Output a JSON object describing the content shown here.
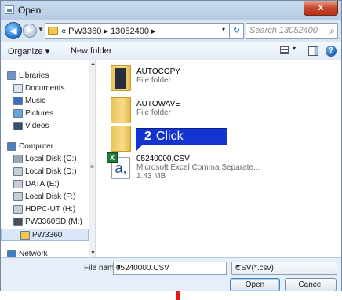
{
  "window": {
    "title": "Open",
    "close_glyph": "x"
  },
  "nav": {
    "back_glyph": "◀",
    "forward_glyph": "▶",
    "history_glyph": "▼",
    "address_path": "« PW3360 ▸ 13052400 ▸",
    "address_dropdown_glyph": "▾",
    "refresh_glyph": "↻",
    "search_placeholder": "Search 13052400",
    "search_glyph": "⌕"
  },
  "toolbar": {
    "organize_label": "Organize ▾",
    "new_folder_label": "New folder",
    "views_dropdown_glyph": "▾",
    "help_glyph": "?"
  },
  "navpane": {
    "scroll_up": "▲",
    "scroll_down": "▼",
    "scroll_mid": "≡",
    "items": [
      {
        "label": "Libraries",
        "icon": "libraries-icon",
        "color": "#6f93c8"
      },
      {
        "label": "Documents",
        "icon": "documents-icon",
        "color": "#dfe6ef"
      },
      {
        "label": "Music",
        "icon": "music-icon",
        "color": "#3f6fc2"
      },
      {
        "label": "Pictures",
        "icon": "pictures-icon",
        "color": "#6aa3d8"
      },
      {
        "label": "Videos",
        "icon": "videos-icon",
        "color": "#3a4f6f"
      },
      {
        "label": "Computer",
        "icon": "computer-icon",
        "color": "#4f7fb8"
      },
      {
        "label": "Local Disk (C:)",
        "icon": "drive-icon",
        "color": "#9ca8b8"
      },
      {
        "label": "Local Disk (D:)",
        "icon": "drive-icon",
        "color": "#c9ced6"
      },
      {
        "label": "DATA (E:)",
        "icon": "drive-icon",
        "color": "#c9ced6"
      },
      {
        "label": "Local Disk (F:)",
        "icon": "drive-icon",
        "color": "#c9ced6"
      },
      {
        "label": "HDPC-UT (H:)",
        "icon": "drive-icon",
        "color": "#c9ced6"
      },
      {
        "label": "PW3360SD (M:)",
        "icon": "sd-drive-icon",
        "color": "#4a4f58"
      },
      {
        "label": "PW3360",
        "icon": "folder-icon",
        "color": "#f0c94a"
      },
      {
        "label": "Network",
        "icon": "network-icon",
        "color": "#3d7bc6"
      }
    ]
  },
  "files": [
    {
      "name": "AUTOCOPY",
      "desc": "File folder",
      "size": "",
      "icon": "folder-icon"
    },
    {
      "name": "AUTOWAVE",
      "desc": "File folder",
      "size": "",
      "icon": "folder-icon"
    },
    {
      "name": "",
      "desc": "",
      "size": "",
      "icon": "folder-icon"
    },
    {
      "name": "05240000.CSV",
      "desc": "Microsoft Excel Comma Separate...",
      "size": "1.43 MB",
      "icon": "excel-csv-icon",
      "badge": "X",
      "glyph": "a,"
    }
  ],
  "callout": {
    "number": "2",
    "text": "Click",
    "color": "#1434d0"
  },
  "bottom": {
    "file_name_label": "File name:",
    "file_name_value": "05240000.CSV",
    "file_type_value": "CSV(*.csv)",
    "dropdown_glyph": "▼",
    "open_label": "Open",
    "cancel_label": "Cancel"
  },
  "annotation": {
    "arrow_color": "#e11a1a"
  }
}
